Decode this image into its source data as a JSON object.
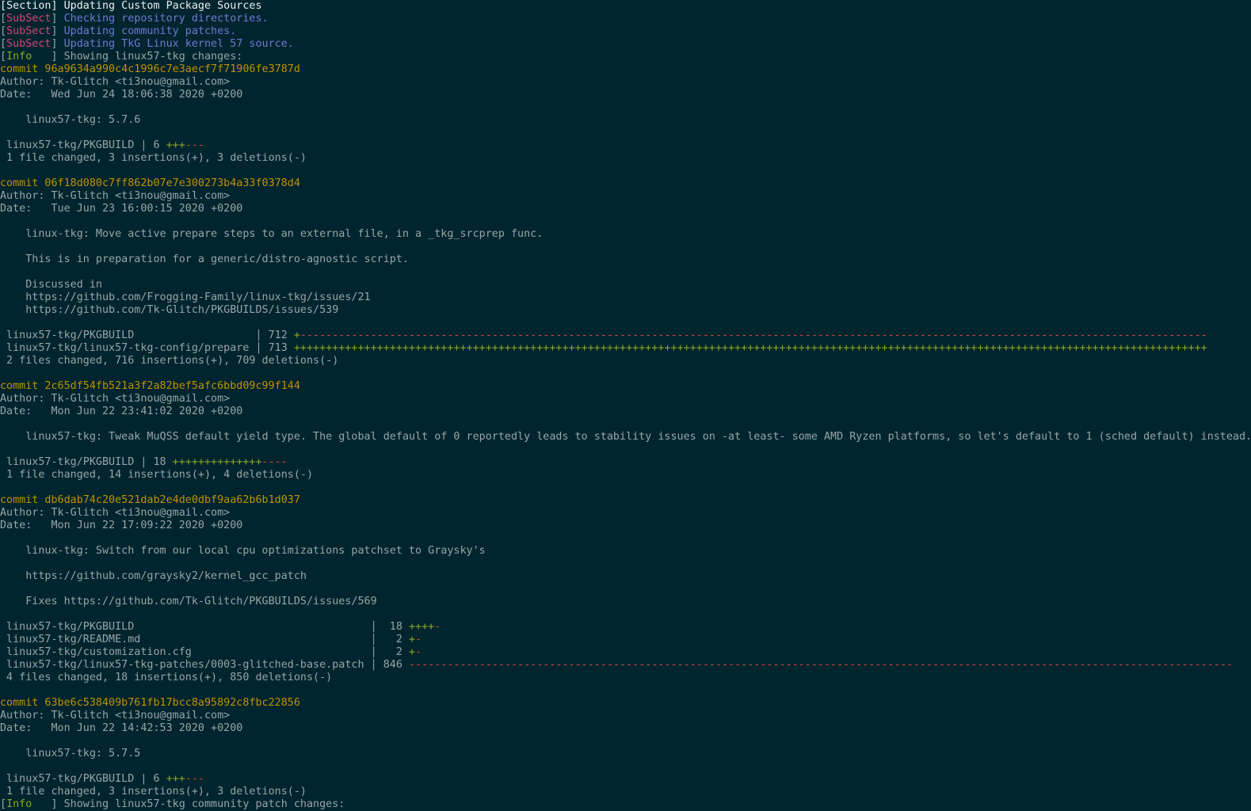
{
  "colors": {
    "background": "#00252e",
    "text": "#98a5a8",
    "section": "#e9eef0",
    "subsect": "#d9447a",
    "subsect_message": "#6f79d6",
    "info": "#8ea81e",
    "commit": "#c29100",
    "insertions": "#8ea81e",
    "deletions": "#d94440"
  },
  "lines": [
    [
      [
        "section",
        "["
      ],
      [
        "section",
        "Section"
      ],
      [
        "section",
        "] Updating Custom Package Sources"
      ]
    ],
    [
      [
        "text",
        "["
      ],
      [
        "subsect",
        "SubSect"
      ],
      [
        "text",
        "] "
      ],
      [
        "blue",
        "Checking repository directories."
      ]
    ],
    [
      [
        "text",
        "["
      ],
      [
        "subsect",
        "SubSect"
      ],
      [
        "text",
        "] "
      ],
      [
        "blue",
        "Updating community patches."
      ]
    ],
    [
      [
        "text",
        "["
      ],
      [
        "subsect",
        "SubSect"
      ],
      [
        "text",
        "] "
      ],
      [
        "blue",
        "Updating TkG Linux kernel 57 source."
      ]
    ],
    [
      [
        "text",
        "["
      ],
      [
        "info",
        "Info   "
      ],
      [
        "text",
        "] Showing linux57-tkg changes:"
      ]
    ],
    [
      [
        "commit",
        "commit 96a9634a990c4c1996c7e3aecf7f71906fe3787d"
      ]
    ],
    [
      [
        "text",
        "Author: Tk-Glitch <ti3nou@gmail.com>"
      ]
    ],
    [
      [
        "text",
        "Date:   Wed Jun 24 18:06:38 2020 +0200"
      ]
    ],
    [],
    [
      [
        "text",
        "    linux57-tkg: 5.7.6"
      ]
    ],
    [],
    [
      [
        "text",
        " linux57-tkg/PKGBUILD | 6 "
      ],
      [
        "add",
        "+++"
      ],
      [
        "del",
        "---"
      ]
    ],
    [
      [
        "text",
        " 1 file changed, 3 insertions(+), 3 deletions(-)"
      ]
    ],
    [],
    [
      [
        "commit",
        "commit 06f18d080c7ff862b07e7e300273b4a33f0378d4"
      ]
    ],
    [
      [
        "text",
        "Author: Tk-Glitch <ti3nou@gmail.com>"
      ]
    ],
    [
      [
        "text",
        "Date:   Tue Jun 23 16:00:15 2020 +0200"
      ]
    ],
    [],
    [
      [
        "text",
        "    linux-tkg: Move active prepare steps to an external file, in a _tkg_srcprep func."
      ]
    ],
    [],
    [
      [
        "text",
        "    This is in preparation for a generic/distro-agnostic script."
      ]
    ],
    [],
    [
      [
        "text",
        "    Discussed in"
      ]
    ],
    [
      [
        "text",
        "    https://github.com/Frogging-Family/linux-tkg/issues/21"
      ]
    ],
    [
      [
        "text",
        "    https://github.com/Tk-Glitch/PKGBUILDS/issues/539"
      ]
    ],
    [],
    [
      [
        "text",
        " linux57-tkg/PKGBUILD                   │ 712 "
      ],
      [
        "add",
        "+"
      ],
      [
        "del",
        "----------------------------------------------------------------------------------------------------------------------------------------------"
      ]
    ],
    [
      [
        "text",
        " linux57-tkg/linux57-tkg-config/prepare │ 713 "
      ],
      [
        "add",
        "+++++++++++++++++++++++++++++++++++++++++++++++++++++++++++++++++++++++++++++++++++++++++++++++++++++++++++++++++++++++++++++++++++++++++++++++"
      ]
    ],
    [
      [
        "text",
        " 2 files changed, 716 insertions(+), 709 deletions(-)"
      ]
    ],
    [],
    [
      [
        "commit",
        "commit 2c65df54fb521a3f2a82bef5afc6bbd09c99f144"
      ]
    ],
    [
      [
        "text",
        "Author: Tk-Glitch <ti3nou@gmail.com>"
      ]
    ],
    [
      [
        "text",
        "Date:   Mon Jun 22 23:41:02 2020 +0200"
      ]
    ],
    [],
    [
      [
        "text",
        "    linux57-tkg: Tweak MuQSS default yield type. The global default of 0 reportedly leads to stability issues on -at least- some AMD Ryzen platforms, so let's default to 1 (sched default) instead."
      ]
    ],
    [],
    [
      [
        "text",
        " linux57-tkg/PKGBUILD | 18 "
      ],
      [
        "add",
        "++++++++++++++"
      ],
      [
        "del",
        "----"
      ]
    ],
    [
      [
        "text",
        " 1 file changed, 14 insertions(+), 4 deletions(-)"
      ]
    ],
    [],
    [
      [
        "commit",
        "commit db6dab74c20e521dab2e4de0dbf9aa62b6b1d037"
      ]
    ],
    [
      [
        "text",
        "Author: Tk-Glitch <ti3nou@gmail.com>"
      ]
    ],
    [
      [
        "text",
        "Date:   Mon Jun 22 17:09:22 2020 +0200"
      ]
    ],
    [],
    [
      [
        "text",
        "    linux-tkg: Switch from our local cpu optimizations patchset to Graysky's"
      ]
    ],
    [],
    [
      [
        "text",
        "    https://github.com/graysky2/kernel_gcc_patch"
      ]
    ],
    [],
    [
      [
        "text",
        "    Fixes https://github.com/Tk-Glitch/PKGBUILDS/issues/569"
      ]
    ],
    [],
    [
      [
        "text",
        " linux57-tkg/PKGBUILD                                     │  18 "
      ],
      [
        "add",
        "++++"
      ],
      [
        "del",
        "-"
      ]
    ],
    [
      [
        "text",
        " linux57-tkg/README.md                                    │   2 "
      ],
      [
        "add",
        "+"
      ],
      [
        "del",
        "-"
      ]
    ],
    [
      [
        "text",
        " linux57-tkg/customization.cfg                            │   2 "
      ],
      [
        "add",
        "+"
      ],
      [
        "del",
        "-"
      ]
    ],
    [
      [
        "text",
        " linux57-tkg/linux57-tkg-patches/0003-glitched-base.patch │ 846 "
      ],
      [
        "del",
        "---------------------------------------------------------------------------------------------------------------------------------"
      ]
    ],
    [
      [
        "text",
        " 4 files changed, 18 insertions(+), 850 deletions(-)"
      ]
    ],
    [],
    [
      [
        "commit",
        "commit 63be6c538409b761fb17bcc8a95892c8fbc22856"
      ]
    ],
    [
      [
        "text",
        "Author: Tk-Glitch <ti3nou@gmail.com>"
      ]
    ],
    [
      [
        "text",
        "Date:   Mon Jun 22 14:42:53 2020 +0200"
      ]
    ],
    [],
    [
      [
        "text",
        "    linux57-tkg: 5.7.5"
      ]
    ],
    [],
    [
      [
        "text",
        " linux57-tkg/PKGBUILD | 6 "
      ],
      [
        "add",
        "+++"
      ],
      [
        "del",
        "---"
      ]
    ],
    [
      [
        "text",
        " 1 file changed, 3 insertions(+), 3 deletions(-)"
      ]
    ],
    [
      [
        "text",
        "["
      ],
      [
        "info",
        "Info   "
      ],
      [
        "text",
        "] Showing linux57-tkg community patch changes:"
      ]
    ]
  ]
}
